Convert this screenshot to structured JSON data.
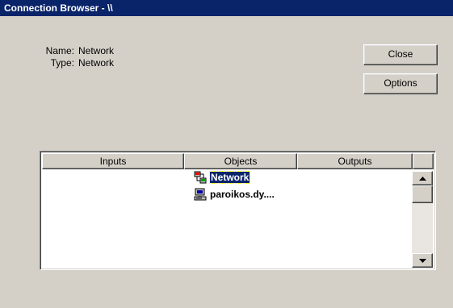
{
  "window": {
    "title": "Connection Browser - \\\\"
  },
  "info": {
    "name_label": "Name:",
    "name_value": "Network",
    "type_label": "Type:",
    "type_value": "Network"
  },
  "buttons": {
    "close": "Close",
    "options": "Options"
  },
  "list": {
    "columns": [
      "Inputs",
      "Objects",
      "Outputs"
    ],
    "objects": [
      {
        "label": "Network",
        "icon": "network-icon",
        "selected": true
      },
      {
        "label": "paroikos.dy....",
        "icon": "computer-icon",
        "selected": false
      }
    ]
  }
}
